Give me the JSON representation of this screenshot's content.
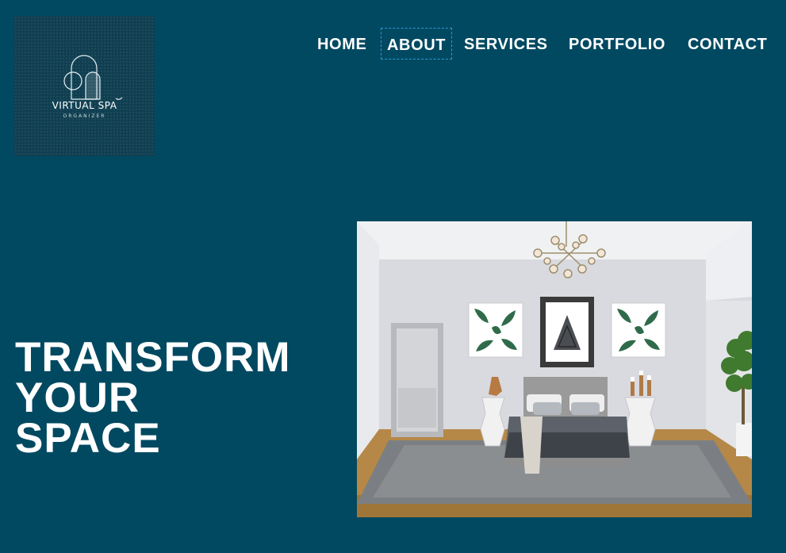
{
  "logo": {
    "name": "VIRTUAL SPA",
    "subtitle": "ORGANIZER"
  },
  "nav": {
    "items": [
      {
        "label": "HOME"
      },
      {
        "label": "ABOUT",
        "focused": true
      },
      {
        "label": "SERVICES"
      },
      {
        "label": "PORTFOLIO"
      },
      {
        "label": "CONTACT"
      }
    ]
  },
  "hero": {
    "title_lines": [
      "TRANSFORM",
      "YOUR",
      "SPACE"
    ]
  },
  "colors": {
    "background": "#014961",
    "text": "#ffffff",
    "focus_outline": "#2e9ad8"
  },
  "image": {
    "icon": "bedroom-interior-image"
  }
}
